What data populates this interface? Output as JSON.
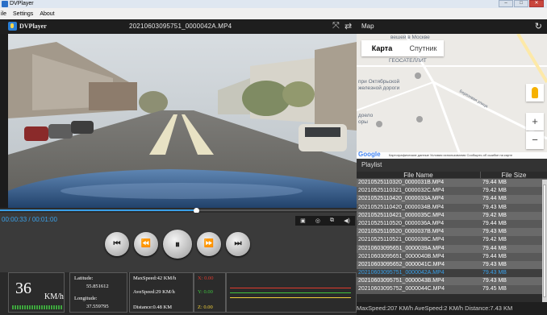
{
  "window": {
    "title": "DVPlayer",
    "minimize": "–",
    "maximize": "□",
    "close": "✕"
  },
  "menu": [
    "ile",
    "Settings",
    "About"
  ],
  "player": {
    "name": "DVPlayer",
    "file": "20210603095751_0000042A.MP4",
    "fullscreen_icon": "⤧",
    "swap_icon": "⇄",
    "elapsed": "00:00:33",
    "separator": " / ",
    "total": "00:01:00",
    "progress_fraction": 0.55,
    "tools": [
      "▣",
      "◎",
      "⧉",
      "◀)"
    ],
    "buttons": [
      "⏮",
      "⏪",
      "⏸",
      "⏩",
      "⏭"
    ]
  },
  "telemetry": {
    "speed": "36",
    "speed_unit": "KM/h",
    "latitude_label": "Latitude:",
    "latitude": "55.851612",
    "longitude_label": "Longitude:",
    "longitude": "37.559795",
    "max_speed": "MaxSpeed:42 KM/h",
    "ave_speed": "AveSpeed:29 KM/h",
    "distance": "Distance:0.48 KM",
    "x": "X: 0.00",
    "y": "Y: 0.00",
    "z": "Z: 0.00",
    "colors": {
      "x": "#e03a2e",
      "y": "#3fc43f",
      "z": "#f2d03a"
    }
  },
  "map": {
    "title": "Map",
    "refresh_icon": "↻",
    "toggle_map": "Карта",
    "toggle_sat": "Спутник",
    "labels": [
      "вешей в Москве",
      "ГЕОСАТЕЛЛИТ",
      "при Октябрьской",
      "железной дороги",
      "Березовая улица",
      "доело",
      "оры"
    ],
    "zoom_in": "+",
    "zoom_out": "−",
    "google": "Google",
    "footer": "Картографические данные   Условия использования   Сообщить об ошибке на карте"
  },
  "playlist": {
    "title": "Playlist",
    "col_name": "File Name",
    "col_size": "File Size",
    "selected_index": 11,
    "rows": [
      {
        "name": "20210525110320_0000031B.MP4",
        "size": "79.44 MB"
      },
      {
        "name": "20210525110321_0000032C.MP4",
        "size": "79.42 MB"
      },
      {
        "name": "20210525110420_0000033A.MP4",
        "size": "79.44 MB"
      },
      {
        "name": "20210525110420_0000034B.MP4",
        "size": "79.43 MB"
      },
      {
        "name": "20210525110421_0000035C.MP4",
        "size": "79.42 MB"
      },
      {
        "name": "20210525110520_0000036A.MP4",
        "size": "79.44 MB"
      },
      {
        "name": "20210525110520_0000037B.MP4",
        "size": "79.43 MB"
      },
      {
        "name": "20210525110521_0000038C.MP4",
        "size": "79.42 MB"
      },
      {
        "name": "20210603095651_0000039A.MP4",
        "size": "79.44 MB"
      },
      {
        "name": "20210603095651_0000040B.MP4",
        "size": "79.44 MB"
      },
      {
        "name": "20210603095652_0000041C.MP4",
        "size": "79.43 MB"
      },
      {
        "name": "20210603095751_0000042A.MP4",
        "size": "79.43 MB"
      },
      {
        "name": "20210603095751_0000043B.MP4",
        "size": "79.43 MB"
      },
      {
        "name": "20210603095752_0000044C.MP4",
        "size": "79.45 MB"
      }
    ],
    "stats": "MaxSpeed:207 KM/h AveSpeed:2 KM/h   Distance:7.43 KM"
  }
}
